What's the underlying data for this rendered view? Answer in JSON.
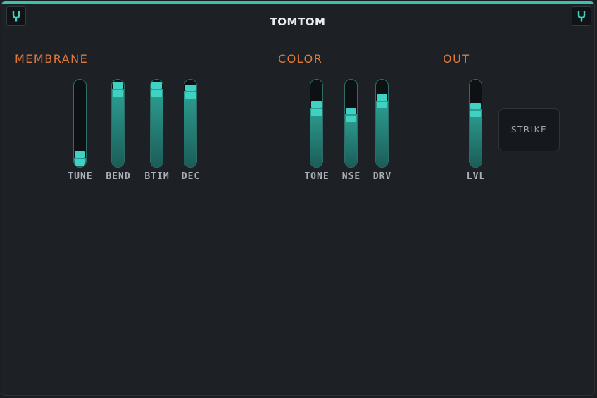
{
  "title": "TOMTOM",
  "colors": {
    "accent": "#3fd2c2",
    "section": "#e07a3a",
    "background": "#1d2025"
  },
  "icons": {
    "left": "tuning-fork-icon",
    "right": "tuning-fork-icon"
  },
  "sections": [
    {
      "label": "MEMBRANE"
    },
    {
      "label": "COLOR"
    },
    {
      "label": "OUT"
    }
  ],
  "sliders": [
    {
      "label": "TUNE",
      "value": 0.08
    },
    {
      "label": "BEND",
      "value": 0.91
    },
    {
      "label": "BTIM",
      "value": 0.91
    },
    {
      "label": "DEC",
      "value": 0.88
    },
    {
      "label": "TONE",
      "value": 0.68
    },
    {
      "label": "NSE",
      "value": 0.6
    },
    {
      "label": "DRV",
      "value": 0.76
    },
    {
      "label": "LVL",
      "value": 0.66
    }
  ],
  "strike_label": "STRIKE"
}
